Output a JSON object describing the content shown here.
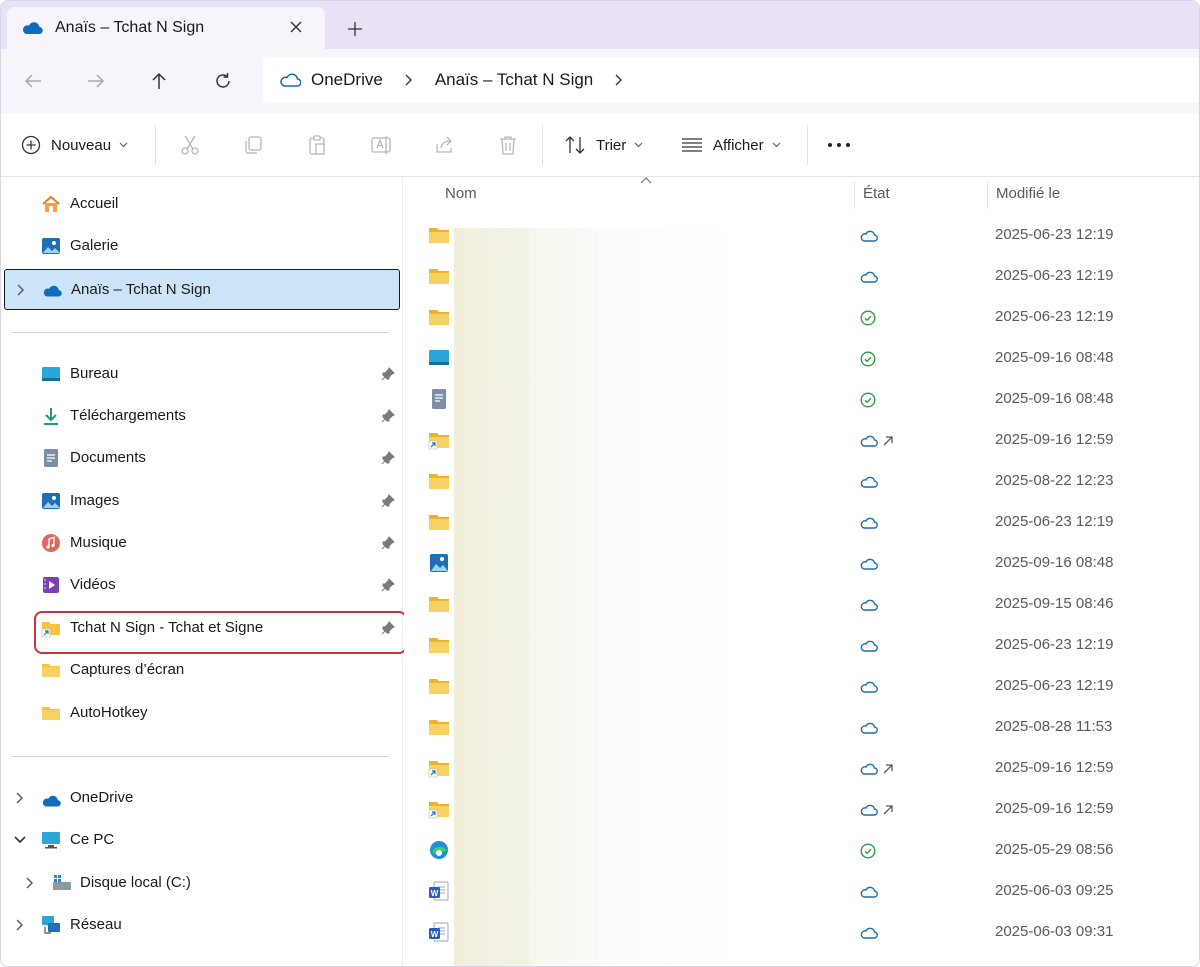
{
  "tab": {
    "title": "Anaïs – Tchat N Sign"
  },
  "breadcrumb": [
    "OneDrive",
    "Anaïs – Tchat N Sign"
  ],
  "toolbar": {
    "new_label": "Nouveau",
    "sort_label": "Trier",
    "view_label": "Afficher"
  },
  "sidebar": {
    "top": [
      {
        "label": "Accueil",
        "icon": "home-icon"
      },
      {
        "label": "Galerie",
        "icon": "gallery-icon"
      },
      {
        "label": "Anaïs – Tchat N Sign",
        "icon": "onedrive-cloud-icon"
      }
    ],
    "pinned": [
      {
        "label": "Bureau",
        "icon": "desktop-icon"
      },
      {
        "label": "Téléchargements",
        "icon": "download-icon"
      },
      {
        "label": "Documents",
        "icon": "documents-icon"
      },
      {
        "label": "Images",
        "icon": "pictures-icon"
      },
      {
        "label": "Musique",
        "icon": "music-icon"
      },
      {
        "label": "Vidéos",
        "icon": "videos-icon"
      },
      {
        "label": "Tchat N Sign - Tchat et Signe",
        "icon": "folder-shortcut-icon"
      },
      {
        "label": "Captures d’écran",
        "icon": "folder-icon"
      },
      {
        "label": "AutoHotkey",
        "icon": "folder-icon"
      }
    ],
    "bottom": [
      {
        "label": "OneDrive",
        "icon": "onedrive-cloud-icon"
      },
      {
        "label": "Ce PC",
        "icon": "computer-icon"
      },
      {
        "label": "Disque local (C:)",
        "icon": "drive-icon"
      },
      {
        "label": "Réseau",
        "icon": "network-icon"
      }
    ]
  },
  "columns": {
    "name": "Nom",
    "status": "État",
    "modified": "Modifié le"
  },
  "files": [
    {
      "icon": "folder-icon",
      "status": "cloud",
      "modified": "2025-06-23 12:19"
    },
    {
      "icon": "folder-icon",
      "status": "cloud",
      "modified": "2025-06-23 12:19"
    },
    {
      "icon": "folder-icon",
      "status": "synced",
      "modified": "2025-06-23 12:19"
    },
    {
      "icon": "desktop-icon",
      "status": "synced",
      "modified": "2025-09-16 08:48"
    },
    {
      "icon": "documents-icon",
      "status": "synced",
      "modified": "2025-09-16 08:48"
    },
    {
      "icon": "folder-shortcut-icon",
      "status": "cloud-shared",
      "modified": "2025-09-16 12:59"
    },
    {
      "icon": "folder-icon",
      "status": "cloud",
      "modified": "2025-08-22 12:23"
    },
    {
      "icon": "folder-icon",
      "status": "cloud",
      "modified": "2025-06-23 12:19"
    },
    {
      "icon": "pictures-icon",
      "status": "cloud",
      "modified": "2025-09-16 08:48"
    },
    {
      "icon": "folder-icon",
      "status": "cloud",
      "modified": "2025-09-15 08:46"
    },
    {
      "icon": "folder-icon",
      "status": "cloud",
      "modified": "2025-06-23 12:19"
    },
    {
      "icon": "folder-icon",
      "status": "cloud",
      "modified": "2025-06-23 12:19"
    },
    {
      "icon": "folder-icon",
      "status": "cloud",
      "modified": "2025-08-28 11:53"
    },
    {
      "icon": "folder-shortcut-icon",
      "status": "cloud-shared",
      "modified": "2025-09-16 12:59"
    },
    {
      "icon": "folder-shortcut-icon",
      "status": "cloud-shared",
      "modified": "2025-09-16 12:59"
    },
    {
      "icon": "edge-icon",
      "status": "synced",
      "modified": "2025-05-29 08:56"
    },
    {
      "icon": "word-icon",
      "status": "cloud",
      "modified": "2025-06-03 09:25"
    },
    {
      "icon": "word-icon",
      "status": "cloud",
      "modified": "2025-06-03 09:31"
    }
  ],
  "colors": {
    "accent": "#0f6cbd",
    "selection": "#cce4f7",
    "highlight_box": "#c4373a",
    "synced": "#2f9a4a"
  }
}
